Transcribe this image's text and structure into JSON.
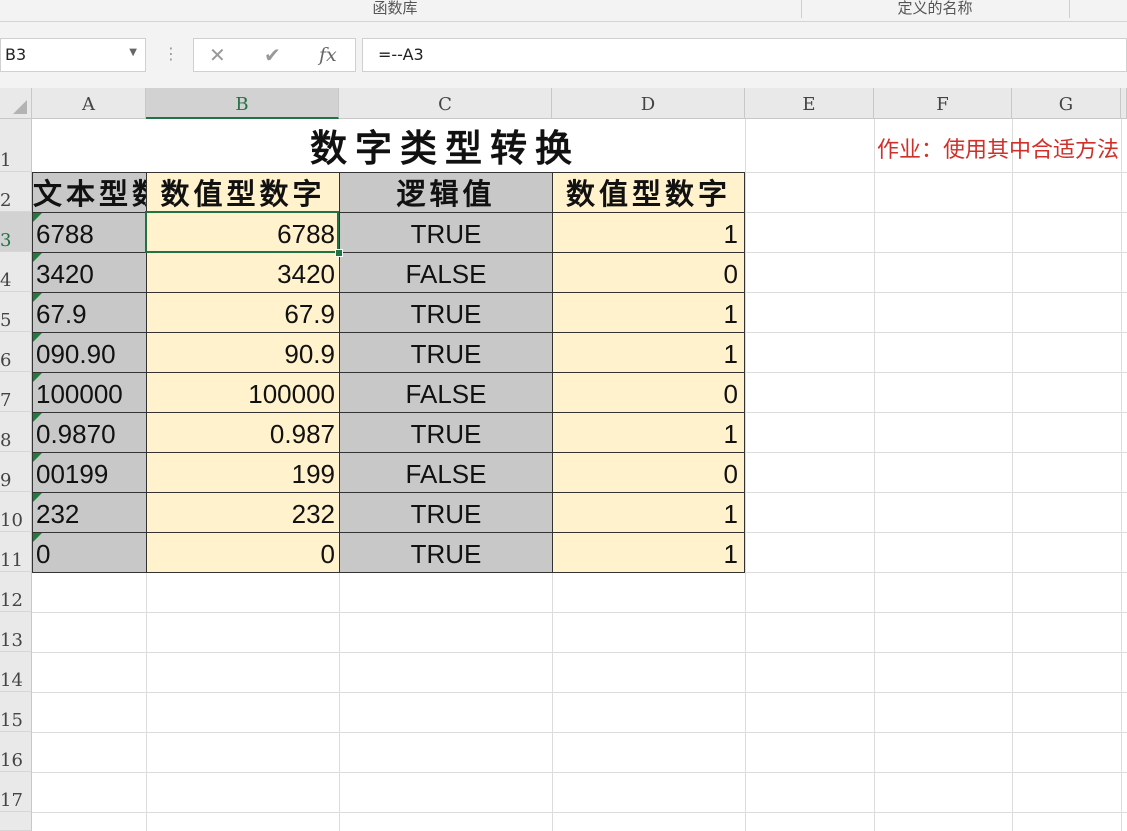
{
  "ribbon": {
    "groups": [
      "函数库",
      "定义的名称"
    ]
  },
  "formula_bar": {
    "name_box": "B3",
    "formula": "=--A3",
    "fx_label": "fx"
  },
  "columns": [
    "A",
    "B",
    "C",
    "D",
    "E",
    "F",
    "G"
  ],
  "rows": [
    "1",
    "2",
    "3",
    "4",
    "5",
    "6",
    "7",
    "8",
    "9",
    "10",
    "11",
    "12",
    "13",
    "14",
    "15",
    "16",
    "17"
  ],
  "sheet": {
    "title": "数字类型转换",
    "homework": "作业：使用其中合适方法",
    "headers": [
      "文本型数",
      "数值型数字",
      "逻辑值",
      "数值型数字"
    ],
    "data": [
      [
        "6788",
        "6788",
        "TRUE",
        "1"
      ],
      [
        "3420",
        "3420",
        "FALSE",
        "0"
      ],
      [
        "67.9",
        "67.9",
        "TRUE",
        "1"
      ],
      [
        "090.90",
        "90.9",
        "TRUE",
        "1"
      ],
      [
        "100000",
        "100000",
        "FALSE",
        "0"
      ],
      [
        "0.9870",
        "0.987",
        "TRUE",
        "1"
      ],
      [
        "00199",
        "199",
        "FALSE",
        "0"
      ],
      [
        "232",
        "232",
        "TRUE",
        "1"
      ],
      [
        "0",
        "0",
        "TRUE",
        "1"
      ]
    ]
  },
  "colors": {
    "gray_fill": "#c8c8c8",
    "yellow_fill": "#fff2cc",
    "selection": "#217346",
    "homework_text": "#d0302a"
  }
}
